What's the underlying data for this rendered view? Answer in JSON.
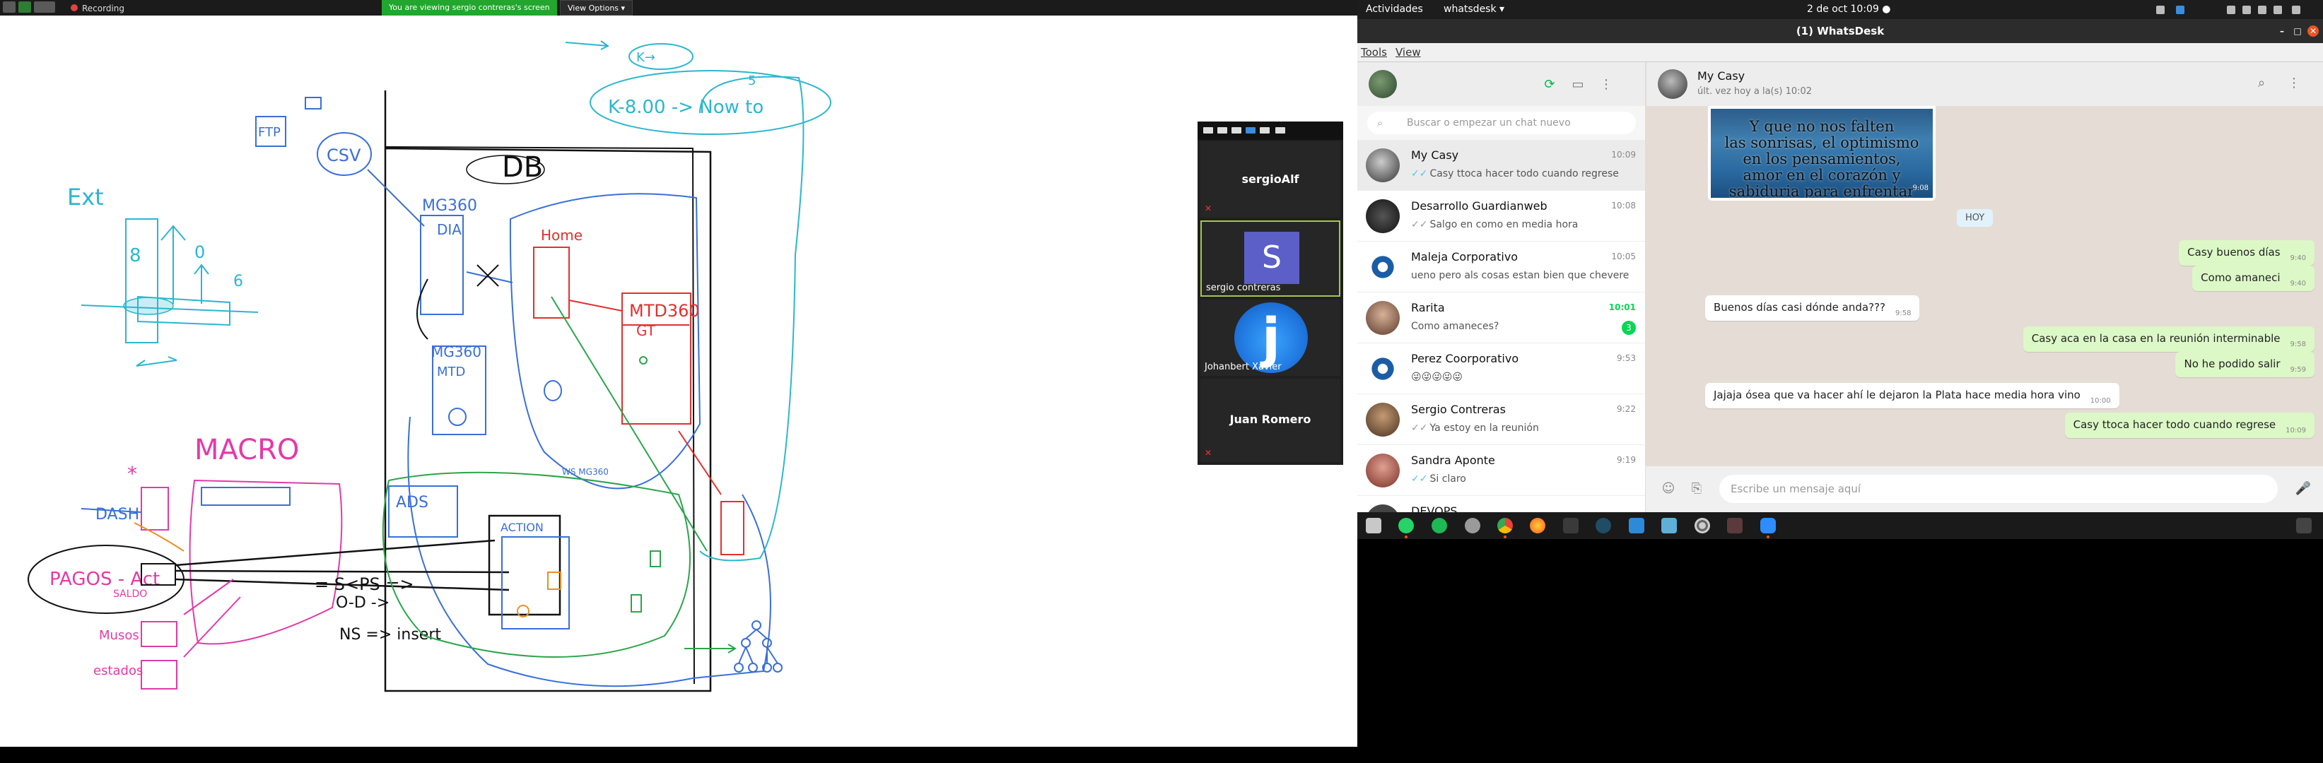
{
  "zoom": {
    "recording_label": "Recording",
    "viewing_banner": "You are viewing sergio contreras's screen",
    "view_options_label": "View Options ▾",
    "participants": [
      {
        "name": "sergioAlf",
        "muted": true
      },
      {
        "name": "sergio contreras",
        "avatar_letter": "S",
        "active_speaker": true
      },
      {
        "name": "Johanbert Xavier",
        "avatar_letter": "j"
      },
      {
        "name": "Juan Romero",
        "muted": true
      }
    ],
    "whiteboard": {
      "labels": {
        "ftp": "FTP",
        "csv": "CSV",
        "ext": "Ext",
        "db": "DB",
        "mg_dia_a": "MG360",
        "mg_dia_b": "DIA",
        "mg_mtd_a": "MG360",
        "mg_mtd_b": "MTD",
        "home": "Home",
        "mtd_gt_a": "MTD360",
        "mtd_gt_b": "GT",
        "macro": "MACRO",
        "pagos_act": "PAGOS - Act",
        "saldo": "SALDO",
        "musos": "Musos",
        "estados": "estados",
        "ns_insert": "NS => insert",
        "s_ps": "= S<PS =>",
        "o_d": "O-D ->",
        "n_eight": "8",
        "n_zero": "0",
        "n_six": "6",
        "n_five": "5",
        "ks": "K→",
        "k_eight": "K-8.00 -> Now to",
        "action": "ACTION",
        "ads": "ADS",
        "ws_mg": "WS MG360",
        "dash": "DASH"
      }
    }
  },
  "system": {
    "activities_label": "Actividades",
    "app_menu_label": "whatsdesk ▾",
    "clock": "2 de oct  10:09  ●"
  },
  "window": {
    "title": "(1) WhatsDesk",
    "menu": [
      "Tools",
      "View"
    ]
  },
  "whatsapp": {
    "search_placeholder": "Buscar o empezar un chat nuevo",
    "chats": [
      {
        "name": "My Casy",
        "time": "10:09",
        "preview": "Casy ttoca hacer todo cuando regrese",
        "ticks": true,
        "active": true,
        "avatar_color": "#9a9a9a"
      },
      {
        "name": "Desarrollo Guardianweb",
        "time": "10:08",
        "preview": "Salgo en como en media hora",
        "ticks": true,
        "avatar_color": "#2c2c2c"
      },
      {
        "name": "Maleja Corporativo",
        "time": "10:05",
        "preview": "ueno pero als cosas estan bien que chevere",
        "ticks": false,
        "avatar_color": "#1a5da6"
      },
      {
        "name": "Rarita",
        "time": "10:01",
        "preview": "Como amaneces?",
        "ticks": false,
        "unread": "3",
        "avatar_color": "#6c4b3a"
      },
      {
        "name": "Perez Coorporativo",
        "time": "9:53",
        "preview": "😜😜😜😜😜",
        "ticks": false,
        "avatar_color": "#1a5da6"
      },
      {
        "name": "Sergio Contreras",
        "time": "9:22",
        "preview": "Ya estoy en la reunión",
        "ticks": true,
        "avatar_color": "#7a5a3a"
      },
      {
        "name": "Sandra Aponte",
        "time": "9:19",
        "preview": "Si claro",
        "ticks": true,
        "avatar_color": "#a0524a"
      },
      {
        "name": "DEVOPS",
        "time": "",
        "preview": "",
        "ticks": false,
        "avatar_color": "#444"
      }
    ],
    "conversation": {
      "name": "My Casy",
      "status": "últ. vez hoy a la(s) 10:02",
      "image_caption": [
        "Y que no nos falten",
        "las sonrisas, el optimismo",
        "en los pensamientos,",
        "amor en el corazón y",
        "sabiduria para enfrentar"
      ],
      "image_time": "9:08",
      "day_chip": "HOY",
      "messages": [
        {
          "text": "Casy buenos días",
          "time": "9:40",
          "out": true
        },
        {
          "text": "Como amaneci",
          "time": "9:40",
          "out": true
        },
        {
          "text": "Buenos días casi  dónde anda???",
          "time": "9:58",
          "out": false
        },
        {
          "text": "Casy aca en la casa en la reunión interminable",
          "time": "9:58",
          "out": true
        },
        {
          "text": "No he podido salir",
          "time": "9:59",
          "out": true
        },
        {
          "text": "Jajaja ósea que va hacer ahí le dejaron la Plata hace media hora vino",
          "time": "10:00",
          "out": false
        },
        {
          "text": "Casy ttoca hacer todo cuando regrese",
          "time": "10:09",
          "out": true
        }
      ],
      "input_placeholder": "Escribe un mensaje aquí"
    }
  },
  "colors": {
    "accent_green": "#06d755",
    "zoom_green": "#22a62d",
    "ubuntu_orange": "#e95420"
  }
}
